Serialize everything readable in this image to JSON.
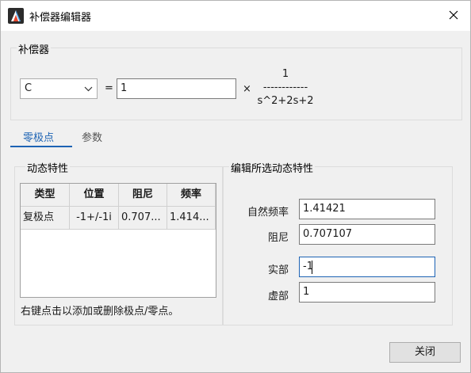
{
  "window": {
    "title": "补偿器编辑器",
    "icon": "app-logo-icon",
    "close_icon": "close-icon"
  },
  "compensator": {
    "group_title": "补偿器",
    "selected_type": "C",
    "equals": "=",
    "gain_value": "1",
    "times": "×",
    "tf_numerator": "1",
    "tf_bar": "------------",
    "tf_denominator": "s^2+2s+2"
  },
  "tabs": [
    {
      "label": "零极点",
      "active": true
    },
    {
      "label": "参数",
      "active": false
    }
  ],
  "dynamics": {
    "group_title": "动态特性",
    "columns": [
      "类型",
      "位置",
      "阻尼",
      "频率"
    ],
    "rows": [
      [
        "复极点",
        "-1+/-1i",
        "0.707...",
        "1.414..."
      ]
    ],
    "hint": "右键点击以添加或删除极点/零点。"
  },
  "edit": {
    "group_title": "编辑所选动态特性",
    "natural_freq_label": "自然频率",
    "natural_freq_value": "1.41421",
    "damping_label": "阻尼",
    "damping_value": "0.707107",
    "real_label": "实部",
    "real_value": "-1",
    "imag_label": "虚部",
    "imag_value": "1"
  },
  "footer": {
    "close_label": "关闭"
  },
  "colors": {
    "accent": "#1d63b4",
    "window_bg": "#f0f0f0",
    "titlebar_bg": "#ffffff"
  }
}
